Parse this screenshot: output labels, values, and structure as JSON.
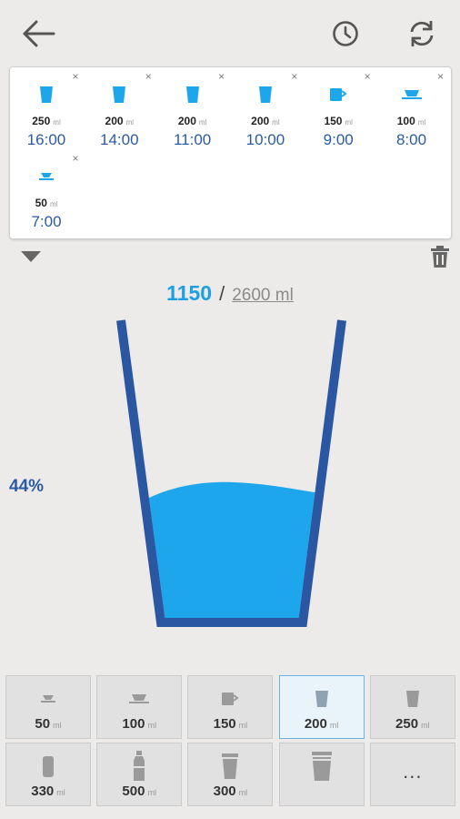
{
  "toolbar": {
    "back_icon": "arrow-left-icon",
    "history_icon": "clock-icon",
    "refresh_icon": "refresh-icon"
  },
  "history": {
    "entries": [
      {
        "amount": "250",
        "unit": "ml",
        "time": "16:00",
        "icon": "glass-icon"
      },
      {
        "amount": "200",
        "unit": "ml",
        "time": "14:00",
        "icon": "glass-icon"
      },
      {
        "amount": "200",
        "unit": "ml",
        "time": "11:00",
        "icon": "glass-icon"
      },
      {
        "amount": "200",
        "unit": "ml",
        "time": "10:00",
        "icon": "glass-icon"
      },
      {
        "amount": "150",
        "unit": "ml",
        "time": "9:00",
        "icon": "mug-icon"
      },
      {
        "amount": "100",
        "unit": "ml",
        "time": "8:00",
        "icon": "cup-icon"
      },
      {
        "amount": "50",
        "unit": "ml",
        "time": "7:00",
        "icon": "small-cup-icon"
      }
    ],
    "delete_glyph": "×"
  },
  "intake": {
    "consumed": "1150",
    "separator": "/",
    "goal": "2600 ml",
    "percent_label": "44%",
    "fill_fraction": 0.44
  },
  "sizes": [
    {
      "value": "50",
      "unit": "ml",
      "icon": "small-cup-icon",
      "selected": false
    },
    {
      "value": "100",
      "unit": "ml",
      "icon": "cup-icon",
      "selected": false
    },
    {
      "value": "150",
      "unit": "ml",
      "icon": "mug-icon",
      "selected": false
    },
    {
      "value": "200",
      "unit": "ml",
      "icon": "glass-icon",
      "selected": true
    },
    {
      "value": "250",
      "unit": "ml",
      "icon": "glass-icon",
      "selected": false
    },
    {
      "value": "330",
      "unit": "ml",
      "icon": "can-icon",
      "selected": false
    },
    {
      "value": "500",
      "unit": "ml",
      "icon": "bottle-icon",
      "selected": false
    },
    {
      "value": "300",
      "unit": "ml",
      "icon": "tall-glass-icon",
      "selected": false
    },
    {
      "value": "",
      "unit": "",
      "icon": "custom-glass-icon",
      "selected": false
    },
    {
      "value": "...",
      "unit": "",
      "icon": "more-icon",
      "selected": false
    }
  ],
  "colors": {
    "accent": "#1c9fe3",
    "dark_blue": "#2a5aa6",
    "glass_outline": "#2b56a2",
    "water": "#1ea6ec",
    "icon_gray": "#9a9a9a"
  }
}
